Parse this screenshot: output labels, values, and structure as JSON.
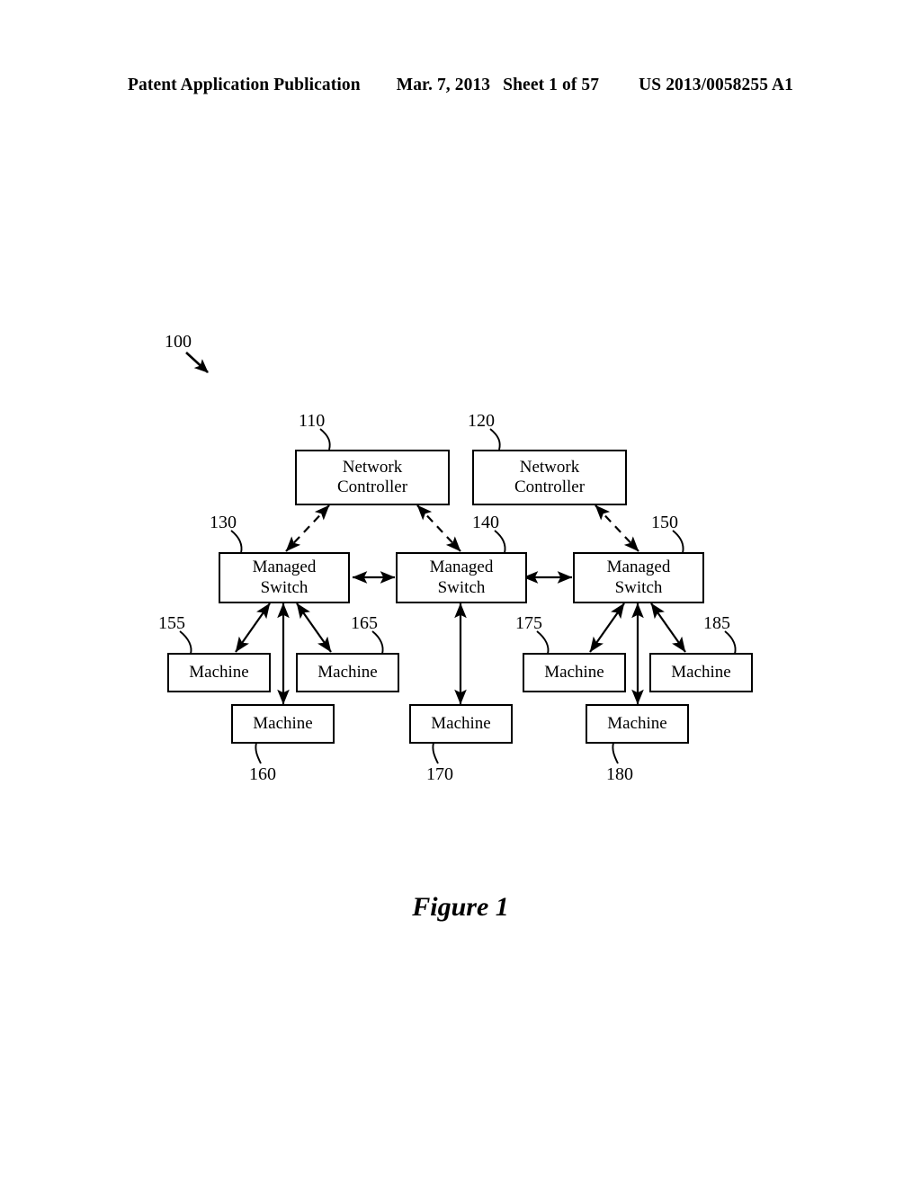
{
  "header": {
    "publication": "Patent Application Publication",
    "date": "Mar. 7, 2013",
    "sheet": "Sheet 1 of 57",
    "patent_number": "US 2013/0058255 A1"
  },
  "figure": {
    "caption": "Figure 1",
    "system_ref": "100",
    "nodes": {
      "controller_left": {
        "ref": "110",
        "line1": "Network",
        "line2": "Controller"
      },
      "controller_right": {
        "ref": "120",
        "line1": "Network",
        "line2": "Controller"
      },
      "switch_left": {
        "ref": "130",
        "line1": "Managed",
        "line2": "Switch"
      },
      "switch_middle": {
        "ref": "140",
        "line1": "Managed",
        "line2": "Switch"
      },
      "switch_right": {
        "ref": "150",
        "line1": "Managed",
        "line2": "Switch"
      },
      "machine_155": {
        "ref": "155",
        "label": "Machine"
      },
      "machine_160": {
        "ref": "160",
        "label": "Machine"
      },
      "machine_165": {
        "ref": "165",
        "label": "Machine"
      },
      "machine_170": {
        "ref": "170",
        "label": "Machine"
      },
      "machine_175": {
        "ref": "175",
        "label": "Machine"
      },
      "machine_180": {
        "ref": "180",
        "label": "Machine"
      },
      "machine_185": {
        "ref": "185",
        "label": "Machine"
      }
    }
  },
  "colors": {
    "ink": "#000000",
    "paper": "#ffffff"
  }
}
